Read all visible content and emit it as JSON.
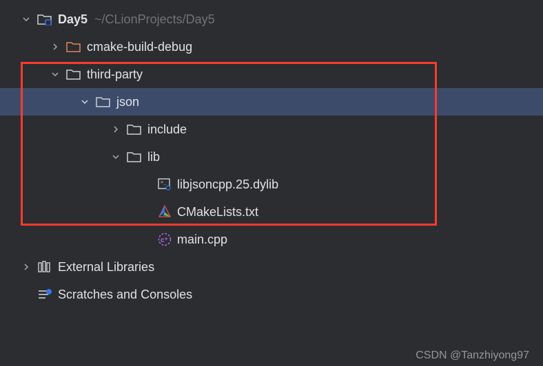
{
  "project": {
    "root_name": "Day5",
    "root_path": "~/CLionProjects/Day5",
    "nodes": {
      "cmake_build_debug": "cmake-build-debug",
      "third_party": "third-party",
      "json": "json",
      "include": "include",
      "lib": "lib",
      "libjsoncpp": "libjsoncpp.25.dylib",
      "cmakelists": "CMakeLists.txt",
      "main_cpp": "main.cpp"
    },
    "external_libraries": "External Libraries",
    "scratches": "Scratches and Consoles"
  },
  "watermark": "CSDN @Tanzhiyong97"
}
